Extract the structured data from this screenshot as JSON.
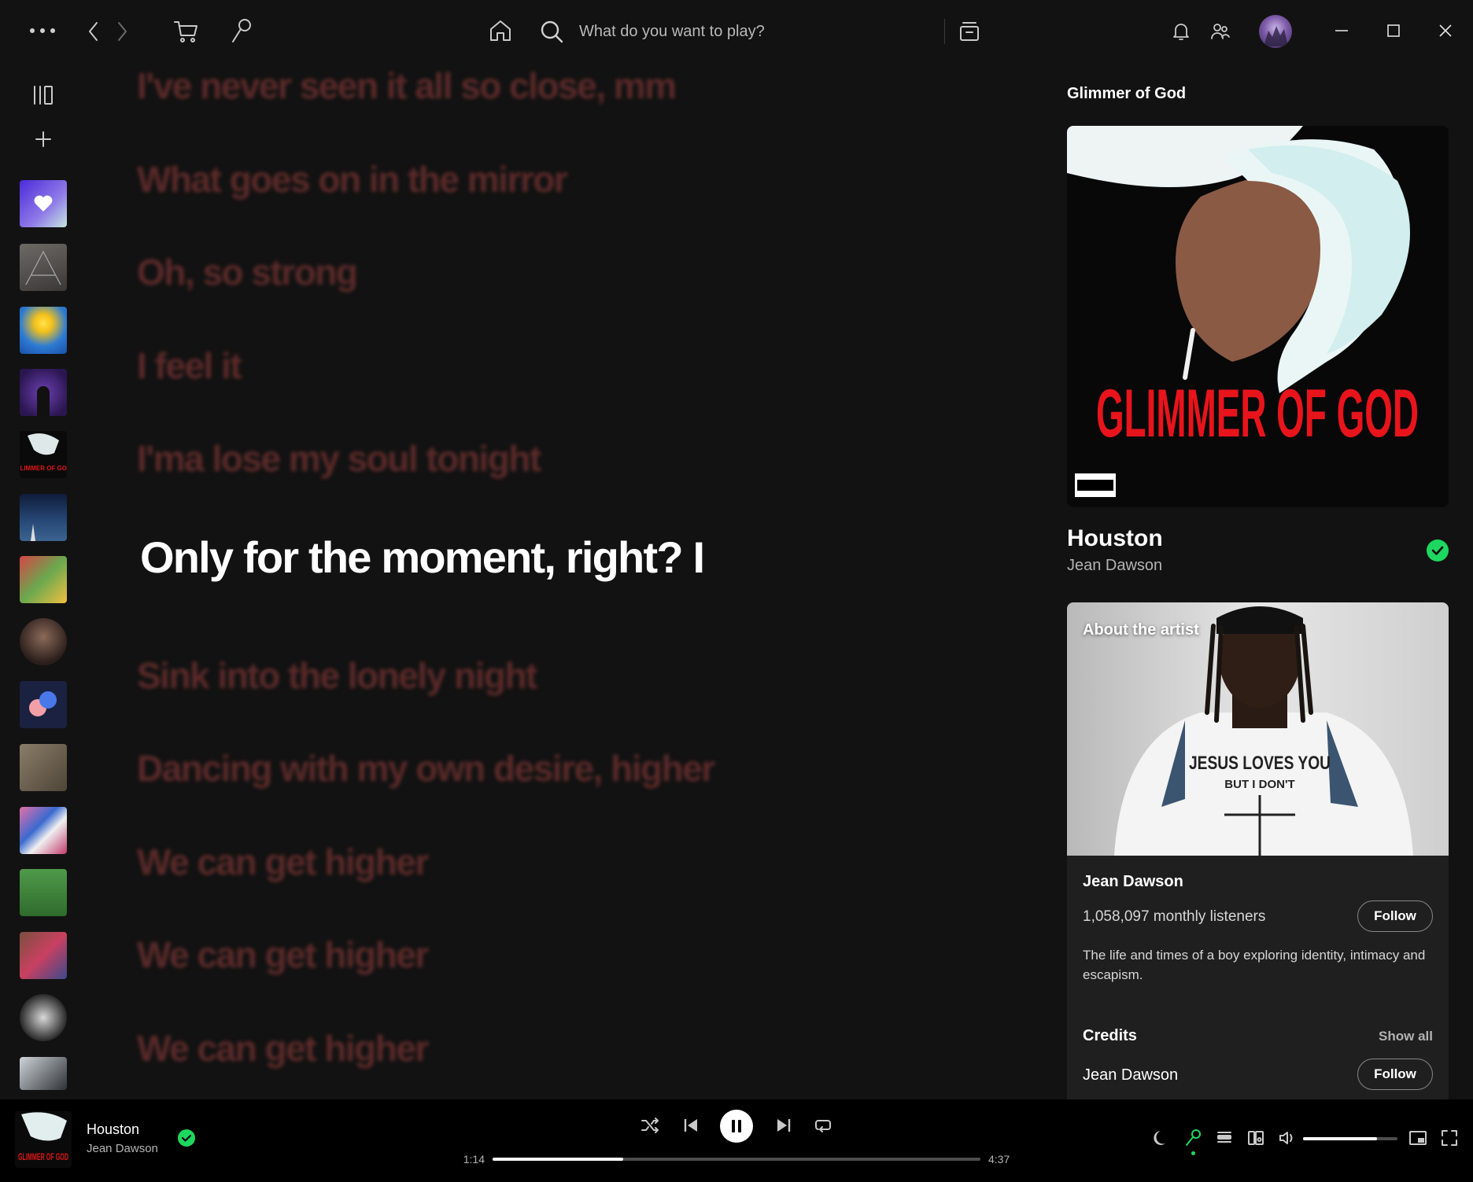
{
  "search": {
    "placeholder": "What do you want to play?"
  },
  "lyrics": {
    "lines": [
      "I've never seen it all so close, mm",
      "What goes on in the mirror",
      "Oh, so strong",
      "I feel it",
      "I'ma lose my soul tonight",
      "Only for the moment, right? I",
      "Sink into the lonely night",
      "Dancing with my own desire, higher",
      "We can get higher",
      "We can get higher",
      "We can get higher"
    ],
    "active_index": 5,
    "colors": {
      "inactive": "#5c2a2a",
      "active": "#ffffff"
    }
  },
  "now_playing_panel": {
    "header": "Glimmer of God",
    "cover_text": "GLIMMER OF GOD",
    "cover_badge": "PARENTAL ADVISORY EXPLICIT CONTENT",
    "track_title": "Houston",
    "track_artist": "Jean Dawson",
    "saved": true
  },
  "about_artist": {
    "label": "About the artist",
    "shirt_text_1": "JESUS LOVES YOU",
    "shirt_text_2": "BUT I DON'T",
    "name": "Jean Dawson",
    "monthly_listeners": "1,058,097 monthly listeners",
    "follow_label": "Follow",
    "bio": "The life and times of a boy exploring identity, intimacy and escapism."
  },
  "credits": {
    "label": "Credits",
    "show_all": "Show all",
    "items": [
      {
        "name": "Jean Dawson",
        "follow_label": "Follow"
      }
    ]
  },
  "player": {
    "track": "Houston",
    "artist": "Jean Dawson",
    "thumb_text": "GLIMMER OF GOD",
    "elapsed": "1:14",
    "duration": "4:37",
    "progress": 0.267,
    "volume": 0.78
  },
  "theme": {
    "accent": "#1ed760",
    "lyric_inactive": "#5c2a2a"
  },
  "icons": [
    "more-icon",
    "back-icon",
    "forward-icon",
    "cart-icon",
    "brush-icon",
    "home-icon",
    "search-icon",
    "browse-icon",
    "bell-icon",
    "friends-icon",
    "avatar",
    "minimize-icon",
    "maximize-icon",
    "close-icon",
    "library-icon",
    "plus-icon",
    "shuffle-icon",
    "previous-icon",
    "pause-icon",
    "next-icon",
    "repeat-icon",
    "sleep-icon",
    "lyrics-icon",
    "queue-icon",
    "connect-icon",
    "volume-icon",
    "miniplayer-icon",
    "fullscreen-icon"
  ]
}
